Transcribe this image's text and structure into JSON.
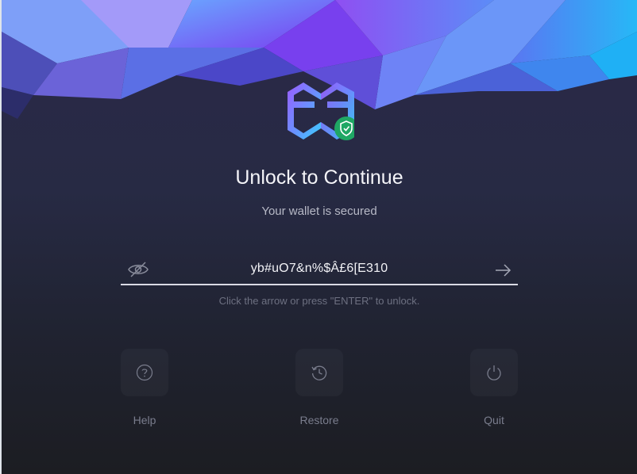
{
  "unlock": {
    "title": "Unlock to Continue",
    "subtitle": "Your wallet is secured",
    "password_value": "yb#uO7&n%$Â£6[E310",
    "hint": "Click the arrow or press \"ENTER\" to unlock."
  },
  "actions": [
    {
      "label": "Help",
      "icon": "help-icon"
    },
    {
      "label": "Restore",
      "icon": "restore-icon"
    },
    {
      "label": "Quit",
      "icon": "power-icon"
    }
  ],
  "colors": {
    "accent_green": "#1faa67",
    "logo_purple": "#8a63ff",
    "logo_blue": "#4bb3ff"
  }
}
